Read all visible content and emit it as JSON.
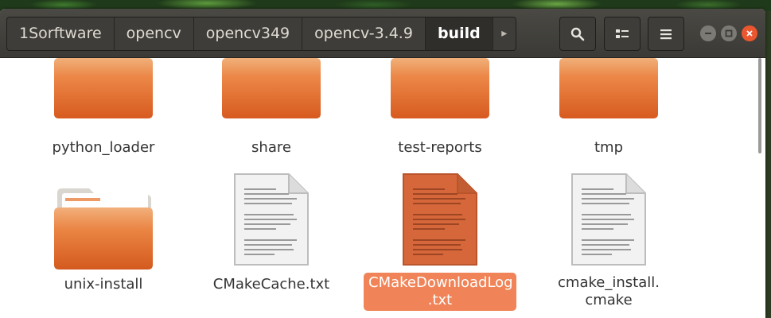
{
  "breadcrumbs": [
    "1Sorftware",
    "opencv",
    "opencv349",
    "opencv-3.4.9",
    "build"
  ],
  "breadcrumb_more": "▸",
  "header_buttons": {
    "search": "search-icon",
    "view": "view-options-icon",
    "menu": "hamburger-menu-icon"
  },
  "window_controls": [
    "minimize-icon",
    "maximize-icon",
    "close-icon"
  ],
  "colors": {
    "accent": "#f08458",
    "folder": "#e07a3a",
    "header": "#3e3d39"
  },
  "files": [
    {
      "name": "python_loader",
      "type": "folder"
    },
    {
      "name": "share",
      "type": "folder"
    },
    {
      "name": "test-reports",
      "type": "folder"
    },
    {
      "name": "tmp",
      "type": "folder"
    },
    {
      "name": "unix-install",
      "type": "folder-open"
    },
    {
      "name": "CMakeCache.txt",
      "type": "text"
    },
    {
      "name": "CMakeDownloadLog.txt",
      "label_lines": [
        "CMakeDownloadLog",
        ".txt"
      ],
      "type": "text",
      "selected": true
    },
    {
      "name": "cmake_install.cmake",
      "label_lines": [
        "cmake_install.",
        "cmake"
      ],
      "type": "text"
    }
  ]
}
